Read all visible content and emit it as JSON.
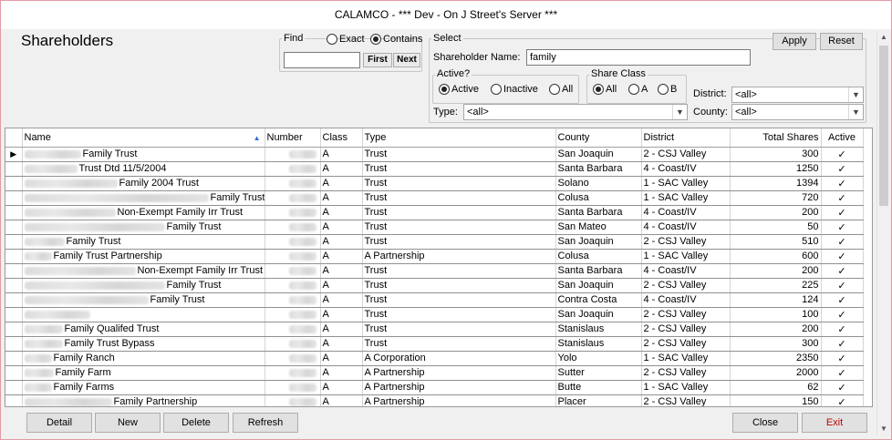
{
  "window": {
    "title": "CALAMCO - *** Dev - On J Street's Server ***"
  },
  "page": {
    "title": "Shareholders"
  },
  "find": {
    "legend": "Find",
    "exact_label": "Exact",
    "contains_label": "Contains",
    "mode": "contains",
    "value": "",
    "first_label": "First",
    "next_label": "Next"
  },
  "select": {
    "legend": "Select",
    "shareholder_name_label": "Shareholder Name:",
    "shareholder_name_value": "family",
    "active_legend": "Active?",
    "active_options": [
      "Active",
      "Inactive",
      "All"
    ],
    "active_selected": "Active",
    "share_class_legend": "Share Class",
    "share_class_options": [
      "All",
      "A",
      "B"
    ],
    "share_class_selected": "All",
    "district_label": "District:",
    "district_value": "<all>",
    "type_label": "Type:",
    "type_value": "<all>",
    "county_label": "County:",
    "county_value": "<all>"
  },
  "actions": {
    "apply_label": "Apply",
    "reset_label": "Reset"
  },
  "grid": {
    "columns": [
      "Name",
      "Number",
      "Class",
      "Type",
      "County",
      "District",
      "Total Shares",
      "Active"
    ],
    "check_glyph": "✓",
    "rows": [
      {
        "name": "Family Trust",
        "cls": "A",
        "type": "Trust",
        "county": "San Joaquin",
        "district": "2 - CSJ Valley",
        "shares": "300"
      },
      {
        "name": "Trust Dtd 11/5/2004",
        "cls": "A",
        "type": "Trust",
        "county": "Santa Barbara",
        "district": "4 - Coast/IV",
        "shares": "1250"
      },
      {
        "name": "Family 2004 Trust",
        "cls": "A",
        "type": "Trust",
        "county": "Solano",
        "district": "1 - SAC Valley",
        "shares": "1394"
      },
      {
        "name": "Family Trust",
        "cls": "A",
        "type": "Trust",
        "county": "Colusa",
        "district": "1 - SAC Valley",
        "shares": "720"
      },
      {
        "name": "Non-Exempt Family Irr Trust",
        "cls": "A",
        "type": "Trust",
        "county": "Santa Barbara",
        "district": "4 - Coast/IV",
        "shares": "200"
      },
      {
        "name": "Family Trust",
        "cls": "A",
        "type": "Trust",
        "county": "San Mateo",
        "district": "4 - Coast/IV",
        "shares": "50"
      },
      {
        "name": "Family Trust",
        "cls": "A",
        "type": "Trust",
        "county": "San Joaquin",
        "district": "2 - CSJ Valley",
        "shares": "510"
      },
      {
        "name": "Family Trust Partnership",
        "cls": "A",
        "type": "A Partnership",
        "county": "Colusa",
        "district": "1 - SAC Valley",
        "shares": "600"
      },
      {
        "name": "Non-Exempt Family Irr Trust",
        "cls": "A",
        "type": "Trust",
        "county": "Santa Barbara",
        "district": "4 - Coast/IV",
        "shares": "200"
      },
      {
        "name": "Family Trust",
        "cls": "A",
        "type": "Trust",
        "county": "San Joaquin",
        "district": "2 - CSJ Valley",
        "shares": "225"
      },
      {
        "name": "Family Trust",
        "cls": "A",
        "type": "Trust",
        "county": "Contra Costa",
        "district": "4 - Coast/IV",
        "shares": "124"
      },
      {
        "name": "",
        "cls": "A",
        "type": "Trust",
        "county": "San Joaquin",
        "district": "2 - CSJ Valley",
        "shares": "100"
      },
      {
        "name": "Family Qualifed Trust",
        "cls": "A",
        "type": "Trust",
        "county": "Stanislaus",
        "district": "2 - CSJ Valley",
        "shares": "200"
      },
      {
        "name": "Family Trust Bypass",
        "cls": "A",
        "type": "Trust",
        "county": "Stanislaus",
        "district": "2 - CSJ Valley",
        "shares": "300"
      },
      {
        "name": "Family Ranch",
        "cls": "A",
        "type": "A Corporation",
        "county": "Yolo",
        "district": "1 - SAC Valley",
        "shares": "2350"
      },
      {
        "name": "Family Farm",
        "cls": "A",
        "type": "A Partnership",
        "county": "Sutter",
        "district": "2 - CSJ Valley",
        "shares": "2000"
      },
      {
        "name": "Family Farms",
        "cls": "A",
        "type": "A Partnership",
        "county": "Butte",
        "district": "1 - SAC Valley",
        "shares": "62"
      },
      {
        "name": "Family Partnership",
        "cls": "A",
        "type": "A Partnership",
        "county": "Placer",
        "district": "2 - CSJ Valley",
        "shares": "150"
      }
    ]
  },
  "footer": {
    "detail_label": "Detail",
    "new_label": "New",
    "delete_label": "Delete",
    "refresh_label": "Refresh",
    "close_label": "Close",
    "exit_label": "Exit"
  }
}
